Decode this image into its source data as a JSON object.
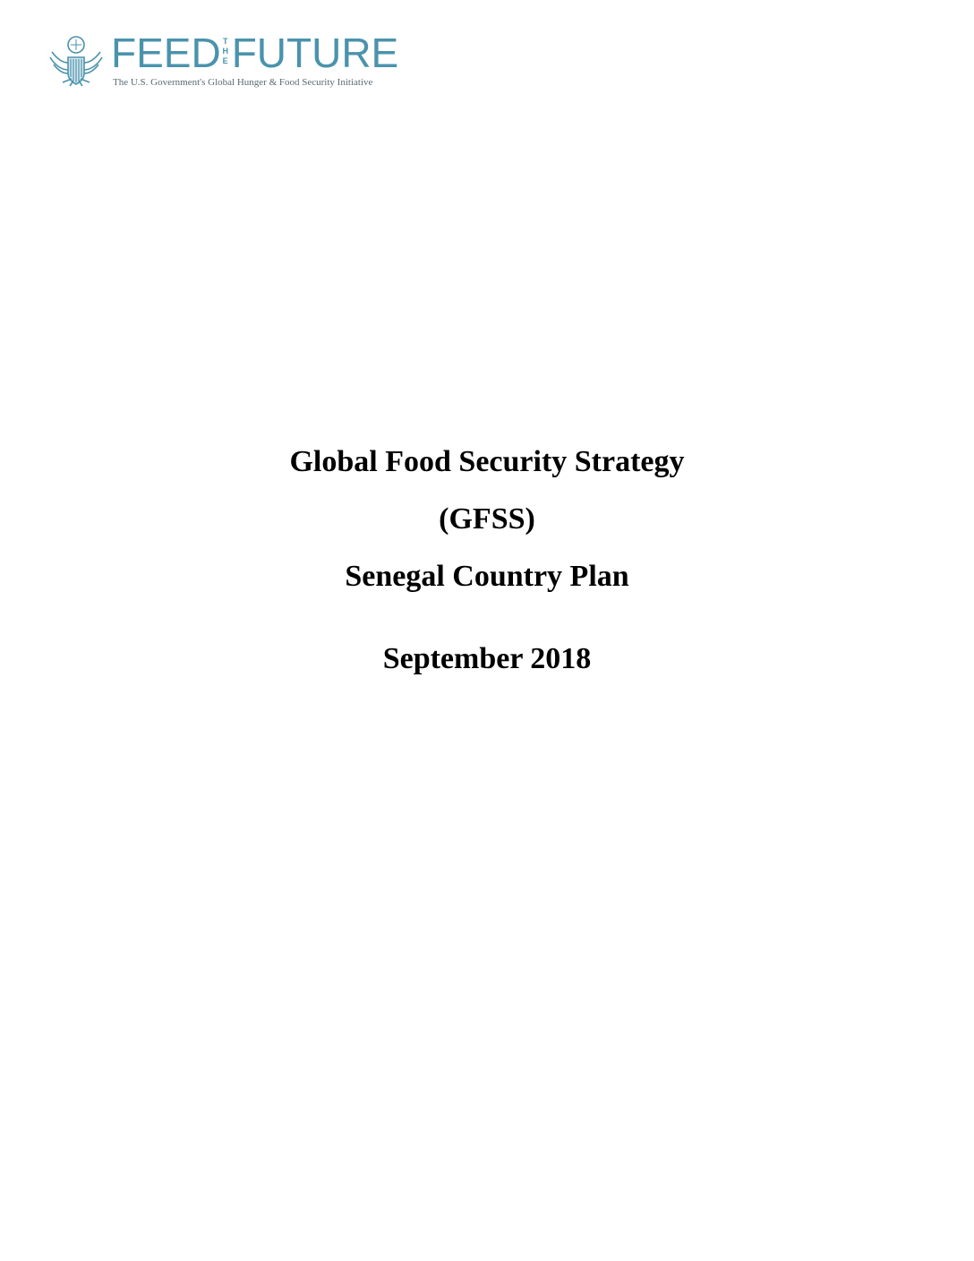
{
  "logo": {
    "word_feed": "FEED",
    "word_the": "THE",
    "word_future": "FUTURE",
    "tagline": "The U.S. Government's Global Hunger & Food Security Initiative",
    "seal_icon": "great-seal-eagle-icon",
    "brand_color": "#4a93ac"
  },
  "title": {
    "line1": "Global Food Security Strategy",
    "line2": "(GFSS)",
    "line3": "Senegal Country Plan",
    "date": "September 2018"
  }
}
